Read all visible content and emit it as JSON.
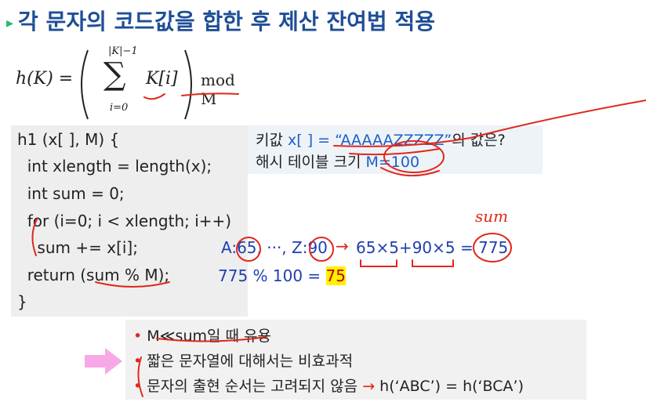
{
  "title": "각 문자의 코드값을 합한 후 제산 잔여법 적용",
  "formula": {
    "lhs": "h(K) =",
    "sum_upper": "|K|−1",
    "sum_lower": "i=0",
    "term": "K[i]",
    "rhs": "mod M"
  },
  "code": [
    "h1 (x[ ], M) {",
    "  int xlength = length(x);",
    "  int sum = 0;",
    "  for (i=0; i < xlength; i++)",
    "    sum += x[i];",
    "  return (sum % M);",
    "}"
  ],
  "info": {
    "line1_prefix": "키값 ",
    "line1_var": "x[ ] = “AAAAAZZZZZ”",
    "line1_suffix": "의 값은?",
    "line2_prefix": "해시 테이블 크기 ",
    "line2_var": "M=100"
  },
  "calc": {
    "a_label": "A:65, ···, Z:90",
    "arrow": "→",
    "expr": "65×5+90×5 = 775",
    "line2_prefix": "775 % 100 = ",
    "result": "75",
    "handwritten": "sum"
  },
  "notes": [
    "M≪sum일 때 유용",
    "짧은 문자열에 대해서는 비효과적",
    "문자의 출현 순서는 고려되지 않음 "
  ],
  "note3_tail": "h(‘ABC’) = h(‘BCA’)",
  "note_bullet": "•",
  "title_arrow": "▸",
  "colors": {
    "title": "#1f4e96",
    "accent_blue": "#1a5fc9",
    "ink_red": "#e0281b",
    "highlight": "#fff200"
  }
}
